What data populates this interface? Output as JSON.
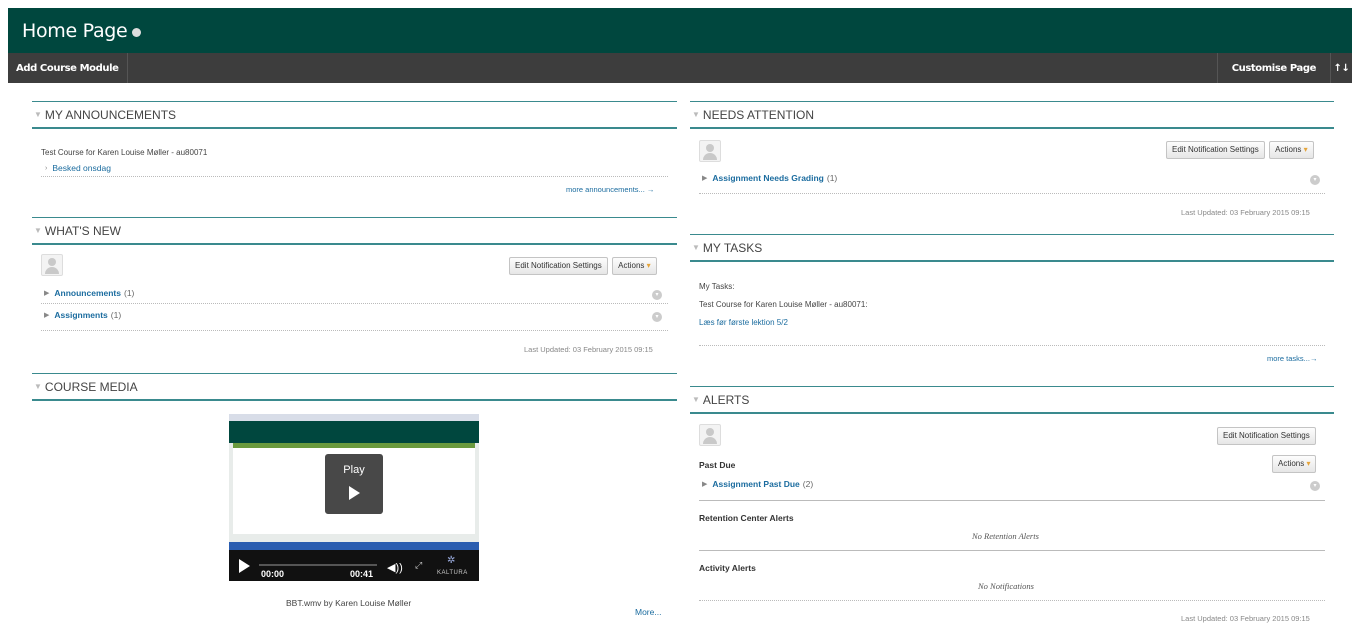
{
  "header": {
    "title": "Home Page"
  },
  "toolbar": {
    "add_module": "Add Course Module",
    "customise": "Customise Page",
    "sort_icon": "↑↓"
  },
  "announcements": {
    "title": "MY ANNOUNCEMENTS",
    "course": "Test Course for Karen Louise Møller - au80071",
    "item": "Besked onsdag",
    "more": "more announcements..."
  },
  "whats_new": {
    "title": "WHAT'S NEW",
    "edit_btn": "Edit Notification Settings",
    "actions_btn": "Actions",
    "items": [
      {
        "label": "Announcements",
        "count": "(1)"
      },
      {
        "label": "Assignments",
        "count": "(1)"
      }
    ],
    "updated": "Last Updated: 03 February 2015 09:15"
  },
  "course_media": {
    "title": "COURSE MEDIA",
    "play": "Play",
    "time_current": "00:00",
    "time_total": "00:41",
    "brand": "KALTURA",
    "caption": "BBT.wmv by Karen Louise Møller",
    "more": "More..."
  },
  "needs_attention": {
    "title": "NEEDS ATTENTION",
    "edit_btn": "Edit Notification Settings",
    "actions_btn": "Actions",
    "items": [
      {
        "label": "Assignment Needs Grading",
        "count": "(1)"
      }
    ],
    "updated": "Last Updated: 03 February 2015 09:15"
  },
  "my_tasks": {
    "title": "MY TASKS",
    "heading": "My Tasks:",
    "course": "Test Course for Karen Louise Møller - au80071:",
    "task": "Læs før første lektion 5/2",
    "more": "more tasks..."
  },
  "alerts": {
    "title": "ALERTS",
    "edit_btn": "Edit Notification Settings",
    "actions_btn": "Actions",
    "past_due": "Past Due",
    "items": [
      {
        "label": "Assignment Past Due",
        "count": "(2)"
      }
    ],
    "retention_title": "Retention Center Alerts",
    "retention_empty": "No Retention Alerts",
    "activity_title": "Activity Alerts",
    "activity_empty": "No Notifications",
    "updated": "Last Updated: 03 February 2015 09:15"
  }
}
